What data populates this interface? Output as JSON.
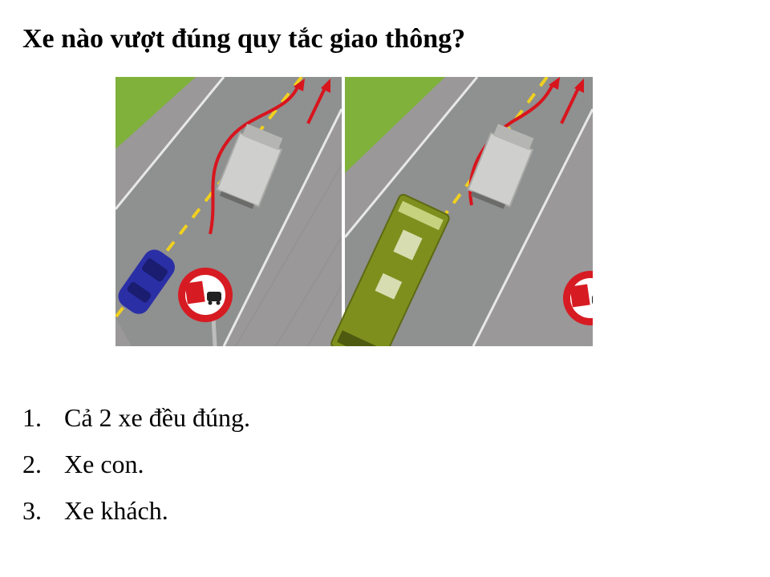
{
  "question": "Xe nào vượt đúng quy tắc giao thông?",
  "illustration": {
    "panels": [
      {
        "vehicle": "xe con",
        "vehicle_color": "#2b2fa6"
      },
      {
        "vehicle": "xe khách",
        "vehicle_color": "#7f8f1e"
      }
    ],
    "sign": "cấm vượt",
    "colors": {
      "grass": "#7fb13b",
      "road": "#8f9090",
      "sidewalk": "#9a9898",
      "arrow": "#d8151d",
      "sign_ring": "#d71b22",
      "truck": "#cfd0cd"
    }
  },
  "options": [
    {
      "number": "1.",
      "text": "Cả 2 xe đều đúng."
    },
    {
      "number": "2.",
      "text": "Xe con."
    },
    {
      "number": "3.",
      "text": "Xe khách."
    }
  ]
}
